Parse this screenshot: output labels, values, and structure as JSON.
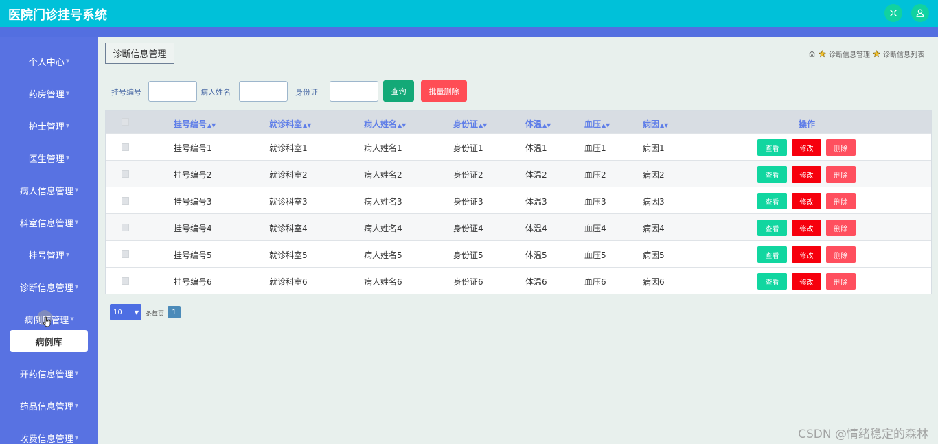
{
  "app": {
    "title": "医院门诊挂号系统"
  },
  "sidebar": {
    "items": [
      {
        "label": "个人中心"
      },
      {
        "label": "药房管理"
      },
      {
        "label": "护士管理"
      },
      {
        "label": "医生管理"
      },
      {
        "label": "病人信息管理"
      },
      {
        "label": "科室信息管理"
      },
      {
        "label": "挂号管理"
      },
      {
        "label": "诊断信息管理"
      },
      {
        "label": "病例库管理"
      },
      {
        "label": "开药信息管理"
      },
      {
        "label": "药品信息管理"
      },
      {
        "label": "收费信息管理"
      }
    ],
    "submenu": {
      "label": "病例库"
    }
  },
  "page": {
    "title": "诊断信息管理",
    "breadcrumb": [
      "诊断信息管理",
      "诊断信息列表"
    ]
  },
  "search": {
    "fields": [
      {
        "label": "挂号编号",
        "value": ""
      },
      {
        "label": "病人姓名",
        "value": ""
      },
      {
        "label": "身份证",
        "value": ""
      }
    ],
    "query_label": "查询",
    "batch_delete_label": "批量删除"
  },
  "table": {
    "columns": [
      "挂号编号",
      "就诊科室",
      "病人姓名",
      "身份证",
      "体温",
      "血压",
      "病因"
    ],
    "action_header": "操作",
    "rows": [
      [
        "挂号编号1",
        "就诊科室1",
        "病人姓名1",
        "身份证1",
        "体温1",
        "血压1",
        "病因1"
      ],
      [
        "挂号编号2",
        "就诊科室2",
        "病人姓名2",
        "身份证2",
        "体温2",
        "血压2",
        "病因2"
      ],
      [
        "挂号编号3",
        "就诊科室3",
        "病人姓名3",
        "身份证3",
        "体温3",
        "血压3",
        "病因3"
      ],
      [
        "挂号编号4",
        "就诊科室4",
        "病人姓名4",
        "身份证4",
        "体温4",
        "血压4",
        "病因4"
      ],
      [
        "挂号编号5",
        "就诊科室5",
        "病人姓名5",
        "身份证5",
        "体温5",
        "血压5",
        "病因5"
      ],
      [
        "挂号编号6",
        "就诊科室6",
        "病人姓名6",
        "身份证6",
        "体温6",
        "血压6",
        "病因6"
      ]
    ],
    "actions": {
      "view": "查看",
      "edit": "修改",
      "delete": "删除"
    }
  },
  "pager": {
    "page_size": "10",
    "per_page_label": "条每页",
    "current_page": "1"
  },
  "watermark": "CSDN @情绪稳定的森林",
  "icons": {
    "fullscreen": "fullscreen-icon",
    "user": "user-icon",
    "home": "home-icon",
    "breadcrumb_sep": "star-icon"
  },
  "colors": {
    "topbar": "#00c1d9",
    "sidebar": "#5872e2",
    "header_text": "#5f7ee8",
    "view": "#11d6a0",
    "edit": "#f6000d",
    "delete": "#ff4f5e"
  }
}
